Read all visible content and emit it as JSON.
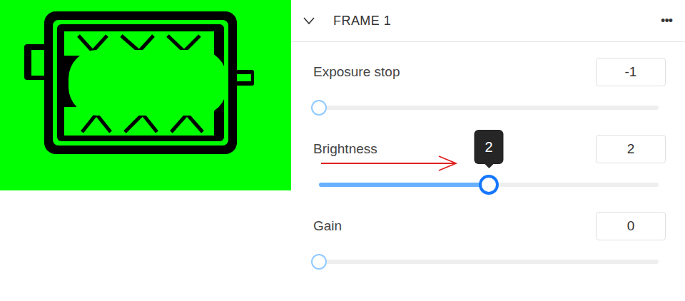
{
  "panel": {
    "title": "FRAME 1",
    "expanded": true,
    "menu": "•••"
  },
  "sliders": [
    {
      "label": "Exposure stop",
      "value": "-1",
      "level": 0,
      "active": false
    },
    {
      "label": "Brightness",
      "value": "2",
      "level": 0.5,
      "active": true,
      "tooltip": "2"
    },
    {
      "label": "Gain",
      "value": "0",
      "level": 0,
      "active": false
    }
  ]
}
